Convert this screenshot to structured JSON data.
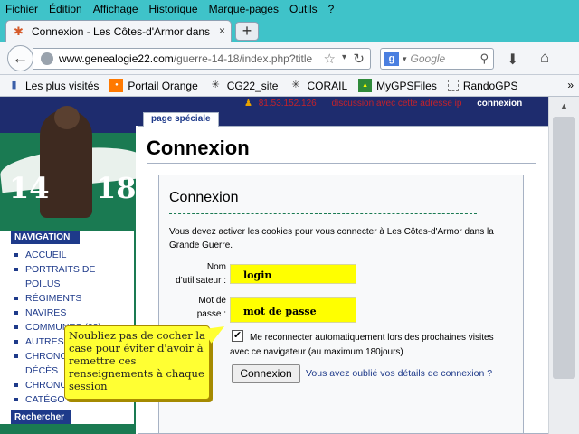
{
  "menu": [
    "Fichier",
    "Édition",
    "Affichage",
    "Historique",
    "Marque-pages",
    "Outils",
    "?"
  ],
  "tab": {
    "title": "Connexion - Les Côtes-d'Armor dans la ...",
    "close": "×",
    "new": "+"
  },
  "nav": {
    "url_domain": "www.genealogie22.com",
    "url_path": "/guerre-14-18/index.php?title",
    "search_engine": "g",
    "search_placeholder": "Google"
  },
  "bookmarks": [
    "Les plus visités",
    "Portail Orange",
    "CG22_site",
    "CORAIL",
    "MyGPSFiles",
    "RandoGPS"
  ],
  "bookmarks_more": "»",
  "userbar": {
    "ip": "81.53.152.126",
    "discussion": "discussion avec cette adresse ip",
    "connexion": "connexion"
  },
  "logo": {
    "left": "14",
    "right": "18"
  },
  "sidebar": {
    "heading": "NAVIGATION",
    "items": [
      "ACCUEIL",
      "PORTRAITS DE",
      "POILUS",
      "RÉGIMENTS",
      "NAVIRES",
      "COMMUNES (22)",
      "AUTRES",
      "CHRONO",
      "DÉCÈS",
      "CHRONO",
      "CATÉGO"
    ],
    "search": "Rechercher"
  },
  "content": {
    "page_tab": "page spéciale",
    "title": "Connexion",
    "box_title": "Connexion",
    "note": "Vous devez activer les cookies pour vous connecter à Les Côtes-d'Armor dans la Grande Guerre.",
    "username_label_1": "Nom",
    "username_label_2": "d'utilisateur :",
    "username_value": "login",
    "password_label_1": "Mot de",
    "password_label_2": "passe :",
    "password_value": "mot de passe",
    "remember": "Me reconnecter automatiquement lors des prochaines visites avec ce navigateur (au maximum 180jours)",
    "check_mark": "✔",
    "submit": "Connexion",
    "forgot": "Vous avez oublié vos détails de connexion ?"
  },
  "tooltip": "Noubliez pas de cocher la case pour éviter d'avoir à remettre ces renseignements à chaque session",
  "colors": {
    "menubar": "#3fc3c9",
    "banner": "#1e2c6e",
    "field": "#ffff00",
    "link": "#1e3a8a",
    "sidebar_green": "#1a7a52"
  }
}
